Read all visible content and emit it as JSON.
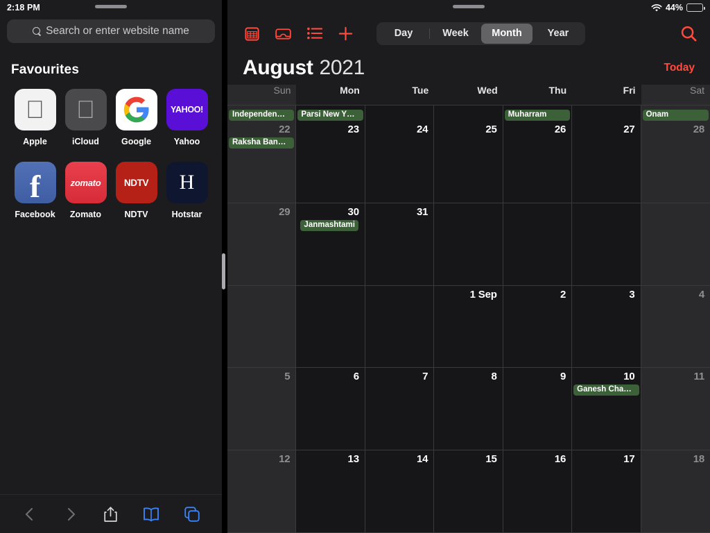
{
  "safari": {
    "status": {
      "time": "2:18 PM"
    },
    "search": {
      "placeholder": "Search or enter website name",
      "icon": "search-icon"
    },
    "favourites": {
      "title": "Favourites",
      "items": [
        {
          "label": "Apple",
          "glyph": "",
          "kind": "apple",
          "tile_bg": "#f2f2f2",
          "fg": "#555555"
        },
        {
          "label": "iCloud",
          "glyph": "",
          "kind": "apple",
          "tile_bg": "#4a4a4d",
          "fg": "#a8a8ac"
        },
        {
          "label": "Google",
          "glyph": "G",
          "kind": "google",
          "tile_bg": "#ffffff",
          "fg": "#4285f4"
        },
        {
          "label": "Yahoo",
          "glyph": "YAHOO!",
          "kind": "yahoo",
          "tile_bg": "#5a0fd6",
          "fg": "#ffffff"
        },
        {
          "label": "Facebook",
          "glyph": "f",
          "kind": "fb",
          "tile_bg": "#4a63a8",
          "fg": "#ffffff"
        },
        {
          "label": "Zomato",
          "glyph": "zomato",
          "kind": "zomato",
          "tile_bg": "#e23744",
          "fg": "#ffffff"
        },
        {
          "label": "NDTV",
          "glyph": "NDTV",
          "kind": "ndtv",
          "tile_bg": "#b52017",
          "fg": "#ffffff"
        },
        {
          "label": "Hotstar",
          "glyph": "H",
          "kind": "hotstar",
          "tile_bg": "#0f1630",
          "fg": "#ffffff"
        }
      ]
    },
    "toolbar": {
      "back": "back-icon",
      "forward": "forward-icon",
      "share": "share-icon",
      "bookmarks": "bookmarks-icon",
      "tabs": "tabs-icon",
      "disabled_color": "#6e6e73",
      "active_color": "#3b82f6",
      "share_color": "#d8d8dc"
    }
  },
  "calendar": {
    "status": {
      "wifi": "wifi-icon",
      "battery_percent": "44%",
      "battery_level": 44
    },
    "toolbar": {
      "icons": [
        {
          "name": "calendars-icon"
        },
        {
          "name": "inbox-icon"
        },
        {
          "name": "list-icon"
        },
        {
          "name": "add-event-icon"
        }
      ],
      "segments": [
        {
          "label": "Day",
          "selected": false
        },
        {
          "label": "Week",
          "selected": false
        },
        {
          "label": "Month",
          "selected": true
        },
        {
          "label": "Year",
          "selected": false
        }
      ],
      "search": "search-icon",
      "accent_color": "#ff4a3d"
    },
    "title": {
      "month": "August",
      "year": "2021",
      "today_label": "Today"
    },
    "weekdays": [
      {
        "label": "Sun",
        "weekend": true
      },
      {
        "label": "Mon",
        "weekend": false
      },
      {
        "label": "Tue",
        "weekend": false
      },
      {
        "label": "Wed",
        "weekend": false
      },
      {
        "label": "Thu",
        "weekend": false
      },
      {
        "label": "Fri",
        "weekend": false
      },
      {
        "label": "Sat",
        "weekend": true
      }
    ],
    "top_partial_row": [
      {
        "weekend": true,
        "event": "Independen…",
        "wide": true
      },
      {
        "weekend": false,
        "event": "Parsi New Y…",
        "wide": true
      },
      {
        "weekend": false,
        "event": null
      },
      {
        "weekend": false,
        "event": null
      },
      {
        "weekend": false,
        "event": "Muharram",
        "wide": true
      },
      {
        "weekend": false,
        "event": null
      },
      {
        "weekend": true,
        "event": "Onam",
        "wide": true
      }
    ],
    "weeks": [
      [
        {
          "num": "22",
          "weekend": true,
          "muted": true,
          "event": "Raksha Ban…",
          "wide": true
        },
        {
          "num": "23",
          "weekend": false,
          "muted": false,
          "event": null
        },
        {
          "num": "24",
          "weekend": false,
          "muted": false,
          "event": null
        },
        {
          "num": "25",
          "weekend": false,
          "muted": false,
          "event": null
        },
        {
          "num": "26",
          "weekend": false,
          "muted": false,
          "event": null
        },
        {
          "num": "27",
          "weekend": false,
          "muted": false,
          "event": null
        },
        {
          "num": "28",
          "weekend": true,
          "muted": true,
          "event": null
        }
      ],
      [
        {
          "num": "29",
          "weekend": true,
          "muted": true,
          "event": null
        },
        {
          "num": "30",
          "weekend": false,
          "muted": false,
          "event": "Janmashtami",
          "wide": false
        },
        {
          "num": "31",
          "weekend": false,
          "muted": false,
          "event": null
        },
        {
          "num": "",
          "weekend": false,
          "muted": false,
          "event": null
        },
        {
          "num": "",
          "weekend": false,
          "muted": false,
          "event": null
        },
        {
          "num": "",
          "weekend": false,
          "muted": false,
          "event": null
        },
        {
          "num": "",
          "weekend": true,
          "muted": true,
          "event": null
        }
      ],
      [
        {
          "num": "",
          "weekend": true,
          "muted": true,
          "event": null
        },
        {
          "num": "",
          "weekend": false,
          "muted": false,
          "event": null
        },
        {
          "num": "",
          "weekend": false,
          "muted": false,
          "event": null
        },
        {
          "num": "1 Sep",
          "weekend": false,
          "muted": false,
          "event": null
        },
        {
          "num": "2",
          "weekend": false,
          "muted": false,
          "event": null
        },
        {
          "num": "3",
          "weekend": false,
          "muted": false,
          "event": null
        },
        {
          "num": "4",
          "weekend": true,
          "muted": true,
          "event": null
        }
      ],
      [
        {
          "num": "5",
          "weekend": true,
          "muted": true,
          "event": null
        },
        {
          "num": "6",
          "weekend": false,
          "muted": false,
          "event": null
        },
        {
          "num": "7",
          "weekend": false,
          "muted": false,
          "event": null
        },
        {
          "num": "8",
          "weekend": false,
          "muted": false,
          "event": null
        },
        {
          "num": "9",
          "weekend": false,
          "muted": false,
          "event": null
        },
        {
          "num": "10",
          "weekend": false,
          "muted": false,
          "event": "Ganesh Cha…",
          "wide": true
        },
        {
          "num": "11",
          "weekend": true,
          "muted": true,
          "event": null
        }
      ],
      [
        {
          "num": "12",
          "weekend": true,
          "muted": true,
          "event": null
        },
        {
          "num": "13",
          "weekend": false,
          "muted": false,
          "event": null
        },
        {
          "num": "14",
          "weekend": false,
          "muted": false,
          "event": null
        },
        {
          "num": "15",
          "weekend": false,
          "muted": false,
          "event": null
        },
        {
          "num": "16",
          "weekend": false,
          "muted": false,
          "event": null
        },
        {
          "num": "17",
          "weekend": false,
          "muted": false,
          "event": null
        },
        {
          "num": "18",
          "weekend": true,
          "muted": true,
          "event": null
        }
      ]
    ],
    "event_color": "#3c6138"
  }
}
